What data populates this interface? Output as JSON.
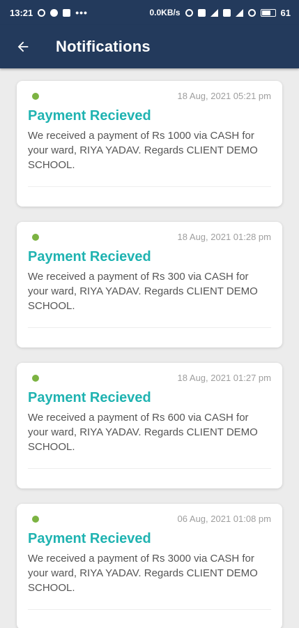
{
  "status_bar": {
    "time": "13:21",
    "dots": "•••",
    "speed": "0.0KB/s",
    "battery": "61"
  },
  "header": {
    "title": "Notifications"
  },
  "notifications": [
    {
      "date": "18 Aug, 2021 05:21 pm",
      "title": "Payment Recieved",
      "body": "We received a payment of Rs 1000 via CASH for your ward, RIYA YADAV. Regards CLIENT DEMO SCHOOL."
    },
    {
      "date": "18 Aug, 2021 01:28 pm",
      "title": "Payment Recieved",
      "body": "We received a payment of Rs 300 via CASH for your ward, RIYA YADAV. Regards CLIENT DEMO SCHOOL."
    },
    {
      "date": "18 Aug, 2021 01:27 pm",
      "title": "Payment Recieved",
      "body": "We received a payment of Rs 600 via CASH for your ward, RIYA YADAV. Regards CLIENT DEMO SCHOOL."
    },
    {
      "date": "06 Aug, 2021 01:08 pm",
      "title": "Payment Recieved",
      "body": "We received a payment of Rs 3000 via CASH for your ward, RIYA YADAV. Regards CLIENT DEMO SCHOOL."
    }
  ],
  "colors": {
    "header_bg": "#233a5c",
    "title_teal": "#1fb3b1",
    "unread_dot": "#7cb342",
    "background": "#ececec"
  }
}
